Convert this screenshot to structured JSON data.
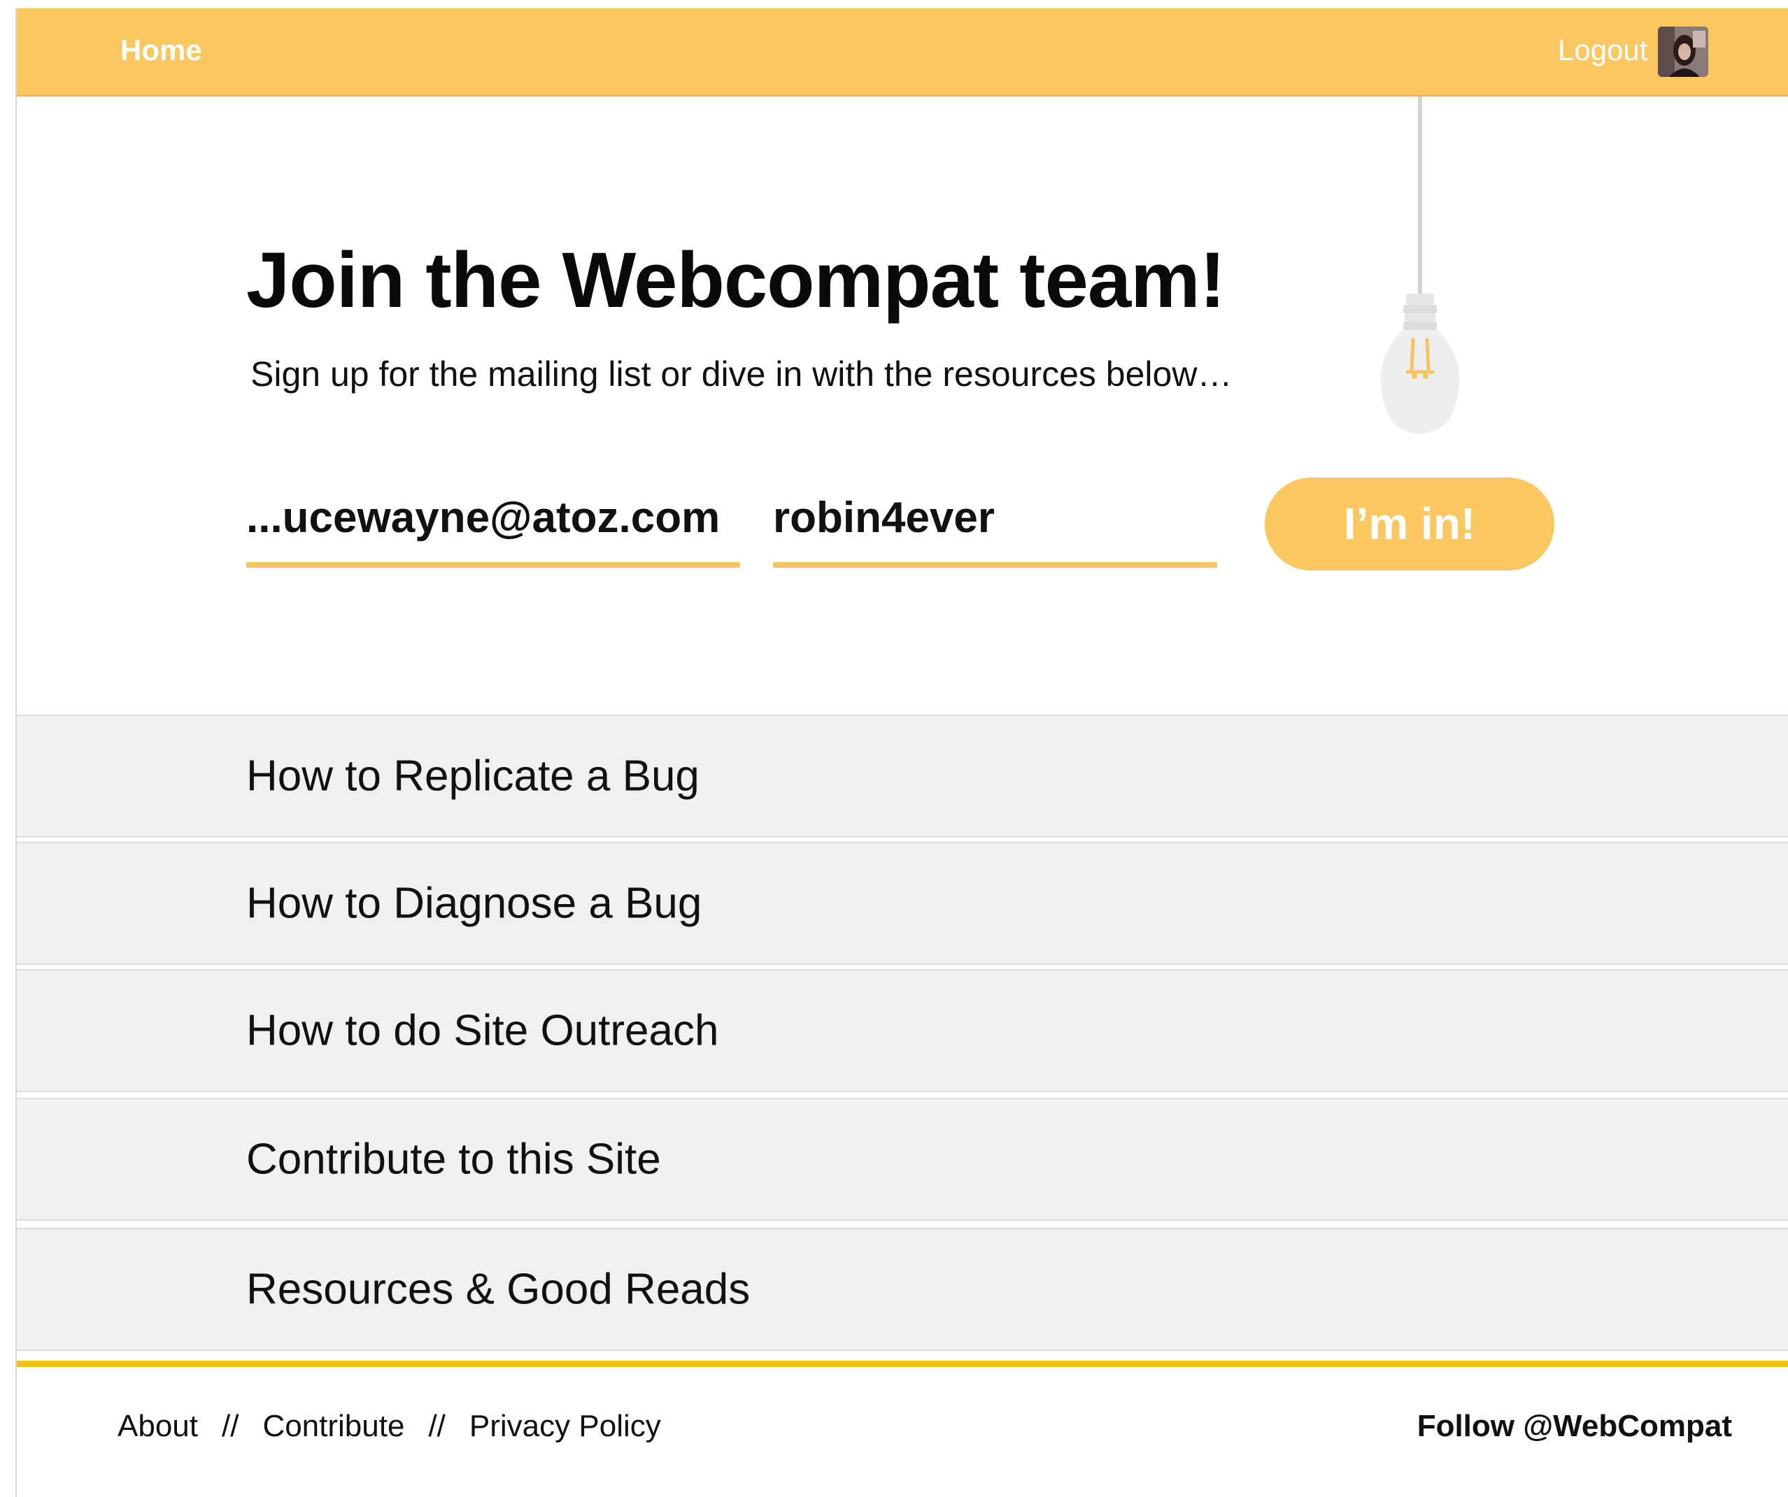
{
  "header": {
    "home_label": "Home",
    "logout_label": "Logout",
    "avatar_icon": "user-avatar",
    "background_color": "#fbc760"
  },
  "hero": {
    "title": "Join the Webcompat team!",
    "subtitle": "Sign up for the mailing list or dive in with the resources below…",
    "lamp_icon": "lightbulb-icon"
  },
  "signup": {
    "email_value": "...ucewayne@atoz.com",
    "password_value": "robin4ever",
    "submit_label": "I’m in!",
    "accent_color": "#fbc760"
  },
  "resources": [
    {
      "label": "How to Replicate a Bug"
    },
    {
      "label": "How to Diagnose a Bug"
    },
    {
      "label": "How to do Site Outreach"
    },
    {
      "label": "Contribute to this Site"
    },
    {
      "label": "Resources & Good Reads"
    }
  ],
  "footer": {
    "links": [
      "About",
      "Contribute",
      "Privacy Policy"
    ],
    "separator": "//",
    "follow_label": "Follow @WebCompat",
    "bar_color": "#f0c21a"
  }
}
